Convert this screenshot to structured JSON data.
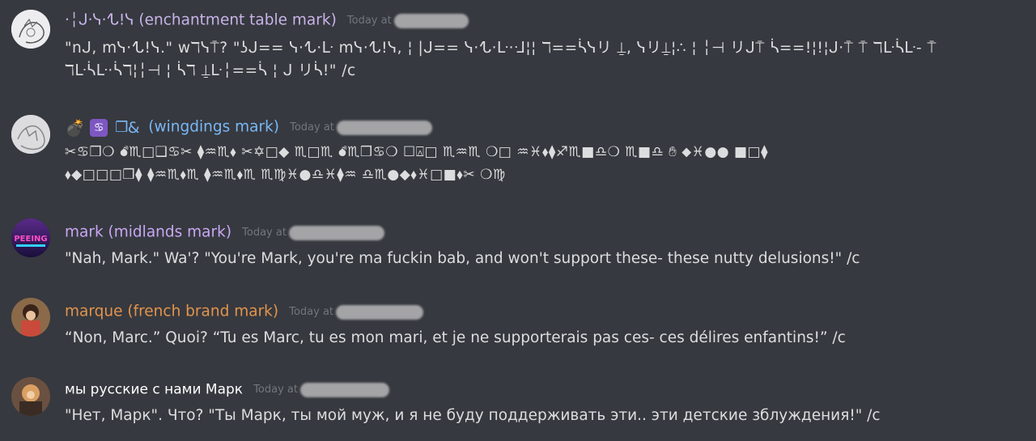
{
  "colors": {
    "background": "#36393f",
    "text": "#dcddde",
    "timestamp": "#72767d",
    "user1": "#c9b3e8",
    "user2": "#7ab7f5",
    "user3": "#c9a7f5",
    "user4": "#e3944d",
    "user5": "#ffffff"
  },
  "messages": [
    {
      "username": "·╎ᒍ·ᓭ·ᖍ!ᓭ (enchantment table mark)",
      "timestamp": "Today at",
      "lines": [
        "\"nᒍ, mᓭ·ᖍ!ᓭ.\" wℸᓭ⍑? \"ʖᒍ== ᓭ·ᖍ·ᒷ mᓭ·ᖍ!ᓭ, ¦ |ᒍ== ᓭ·ᖍ·ᒷ·ᒲ¦¦ ℸ==ᓵᓭリ ⍊, ᓭリ⍊¦∴ ¦ ╎⊣ リᒍ⍑ ᓵ==!¦!¦ᒍ·⍑ ⍑ ℸᒷᓵᒷ- ⍑",
        "ℸᒷᓵᒷ·ᓵℸ¦╎⊣ ¦ ᓵℸ ⍊ᒷ╎==ᓵ ¦ ᒍ リᓵ!\" /c"
      ]
    },
    {
      "username": "wingdings mark",
      "emoji_names": [
        "bomb-emoji",
        "cancer-emoji",
        "box-emoji",
        "ampersand-emoji"
      ],
      "timestamp": "Today at",
      "lines": [
        "✂︎♋︎❒︎❍︎ 💣︎♏︎□︎❑︎♋︎✂︎ ⧫︎♒︎♏︎⬧︎ ✂︎✡︎□︎◆︎ ♏︎□︎♏︎ 💣︎♏︎❒︎♋︎❍︎ ☐︎⍓︎□︎ ♏︎♒︎♏︎ ❍︎□︎ ♒︎♓︎⬧︎⧫︎♐︎♏︎■︎♎︎❍︎ ♏︎■︎♎︎ ✋︎ ⬥︎♓︎●︎● ■︎□︎⧫︎",
        "⬧︎◆︎□︎□︎□︎❒︎⧫︎ ⧫︎♒︎♏︎⬧︎♏︎ ⧫︎♒︎♏︎⬧︎♏︎ ♏︎♍︎♓︎●︎♎︎♓︎⧫︎♒︎ ♎︎♏︎●︎◆︎⬧︎♓︎□︎■︎⬧︎✂︎ ❍︎♍︎"
      ]
    },
    {
      "username": "mark (midlands mark)",
      "timestamp": "Today at",
      "lines": [
        "\"Nah, Mark.\" Wa'? \"You're Mark, you're ma fuckin bab, and won't support these- these nutty delusions!\" /c"
      ]
    },
    {
      "username": "marque (french brand mark)",
      "timestamp": "Today at",
      "lines": [
        "“Non, Marc.” Quoi? “Tu es Marc, tu es mon mari, et je ne supporterais pas ces- ces délires enfantins!” /c"
      ]
    },
    {
      "username": "мы русские с нами Марк",
      "timestamp": "Today at",
      "lines": [
        "\"Нет, Марк\". Что? \"Ты Марк, ты мой муж, и я не буду поддерживать эти.. эти детские зблуждения!\" /c"
      ]
    }
  ]
}
